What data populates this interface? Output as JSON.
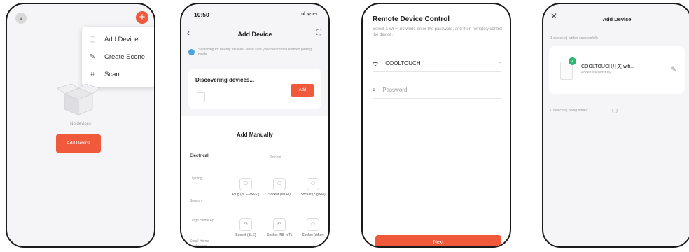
{
  "screen1": {
    "menu": [
      {
        "icon": "monitor-icon",
        "glyph": "⬚",
        "label": "Add Device"
      },
      {
        "icon": "edit-icon",
        "glyph": "✎",
        "label": "Create Scene"
      },
      {
        "icon": "scan-icon",
        "glyph": "⌗",
        "label": "Scan"
      }
    ],
    "empty_label": "No devices",
    "add_button": "Add Device"
  },
  "screen2": {
    "time": "10:50",
    "status_icons": "ııl ᯤ ▭",
    "title": "Add Device",
    "notice": "Searching for nearby devices. Make sure your device has entered pairing mode.",
    "discovering_title": "Discovering devices...",
    "add_button": "Add",
    "add_manually": "Add Manually",
    "categories": [
      "Electrical",
      "Lighting",
      "Sensors",
      "Large Home Ap...",
      "Small Home Appliances"
    ],
    "section_label": "Socket",
    "devices_row1": [
      "Plug (BLE+Wi-Fi)",
      "Socket (Wi-Fi)",
      "Socket (Zigbee)"
    ],
    "devices_row2": [
      "Socket (BLE)",
      "Socket (NB-IoT)",
      "Socket (other)"
    ]
  },
  "screen3": {
    "title": "Remote Device Control",
    "subtitle": "Select a Wi-Fi network, enter the password, and then remotely control the device.",
    "wifi_name": "COOLTOUCH",
    "wifi_suffix": "",
    "password_placeholder": "Password",
    "next_button": "Next"
  },
  "screen4": {
    "title": "Add Device",
    "added_label": "1 device(s) added successfully",
    "device_name": "COOLTOUCH开关 wifi...",
    "device_status": "Added successfully",
    "being_added": "0 device(s) being added"
  },
  "colors": {
    "accent": "#f0593a",
    "success": "#2bb673"
  }
}
